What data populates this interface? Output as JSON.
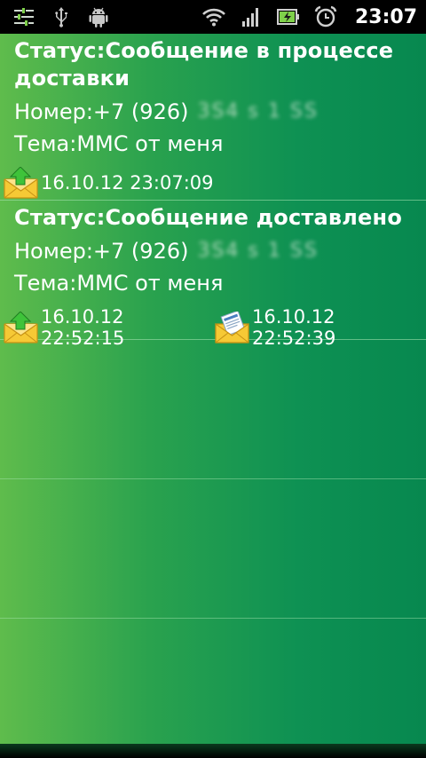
{
  "status_bar": {
    "time": "23:07",
    "icons_left": [
      "sliders-icon",
      "usb-icon",
      "android-icon"
    ],
    "icons_right": [
      "wifi-icon",
      "signal-icon",
      "battery-charging-icon",
      "alarm-clock-icon"
    ]
  },
  "messages": [
    {
      "status": "Статус:Сообщение в процессе доставки",
      "number_label": "Номер:+7 (926)",
      "number_hidden": "3S4 s 1 SS",
      "subject": "Тема:MMC от меня",
      "events": [
        {
          "icon": "envelope-sent-icon",
          "time": "16.10.12 23:07:09"
        }
      ]
    },
    {
      "status": "Статус:Сообщение доставлено",
      "number_label": "Номер:+7 (926)",
      "number_hidden": "3S4 s 1 SS",
      "subject": "Тема:MMC от меня",
      "events": [
        {
          "icon": "envelope-sent-icon",
          "time": "16.10.12 22:52:15"
        },
        {
          "icon": "envelope-delivered-icon",
          "time": "16.10.12 22:52:39"
        }
      ]
    }
  ],
  "colors": {
    "background_left": "#5fbc4c",
    "background_right": "#07884f",
    "text": "#ffffff"
  }
}
